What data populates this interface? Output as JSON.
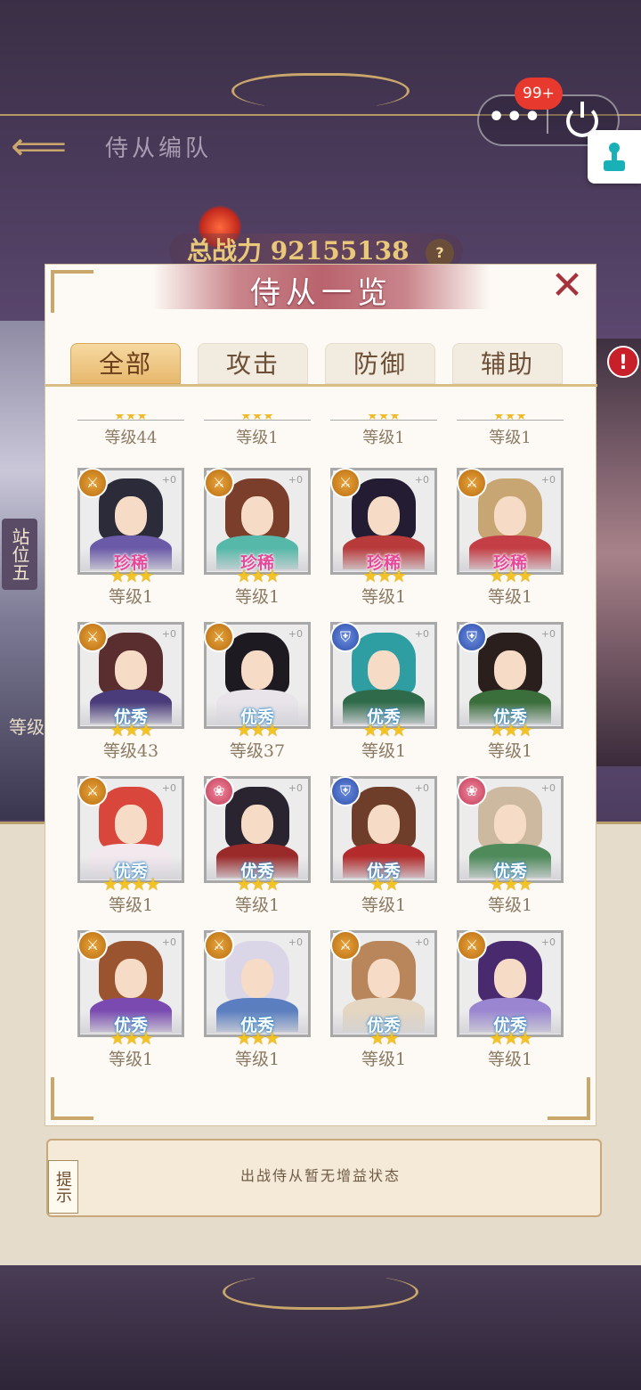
{
  "background": {
    "team_title": "侍从编队",
    "power_label": "总战力",
    "power_value": "92155138",
    "help": "?",
    "stand_tag": "站位五",
    "left_level": "等级",
    "alert": "!",
    "tip_label": "提示",
    "tip_text": "出战侍从暂无增益状态"
  },
  "capsule": {
    "more": "•••",
    "badge": "99+"
  },
  "modal": {
    "title": "侍从一览",
    "close": "✕",
    "tabs": [
      {
        "label": "全部",
        "active": true
      },
      {
        "label": "攻击",
        "active": false
      },
      {
        "label": "防御",
        "active": false
      },
      {
        "label": "辅助",
        "active": false
      }
    ],
    "partial_row": [
      {
        "level": "等级44"
      },
      {
        "level": "等级1"
      },
      {
        "level": "等级1"
      },
      {
        "level": "等级1"
      }
    ],
    "cards": [
      {
        "role": "sword",
        "rarity": "珍稀",
        "tier": "rare",
        "stars": "★★★",
        "level": "等级1",
        "plus": "+0",
        "hair": "#2b2b3a",
        "robe": "#6b5aa8"
      },
      {
        "role": "sword",
        "rarity": "珍稀",
        "tier": "rare",
        "stars": "★★★",
        "level": "等级1",
        "plus": "+0",
        "hair": "#7a3e2a",
        "robe": "#55b8a8"
      },
      {
        "role": "sword",
        "rarity": "珍稀",
        "tier": "rare",
        "stars": "★★★",
        "level": "等级1",
        "plus": "+0",
        "hair": "#231c33",
        "robe": "#b83a3a"
      },
      {
        "role": "sword",
        "rarity": "珍稀",
        "tier": "rare",
        "stars": "★★★",
        "level": "等级1",
        "plus": "+0",
        "hair": "#c8a673",
        "robe": "#c43f45"
      },
      {
        "role": "sword",
        "rarity": "优秀",
        "tier": "good",
        "stars": "★★★",
        "level": "等级43",
        "plus": "+0",
        "hair": "#5a2e2e",
        "robe": "#4a3b7a"
      },
      {
        "role": "sword",
        "rarity": "优秀",
        "tier": "good",
        "stars": "★★★",
        "level": "等级37",
        "plus": "+0",
        "hair": "#1e1a22",
        "robe": "#e8e4ea"
      },
      {
        "role": "shield",
        "rarity": "优秀",
        "tier": "good",
        "stars": "★★★",
        "level": "等级1",
        "plus": "+0",
        "hair": "#2e9ea2",
        "robe": "#2f6b4a"
      },
      {
        "role": "shield",
        "rarity": "优秀",
        "tier": "good",
        "stars": "★★★",
        "level": "等级1",
        "plus": "+0",
        "hair": "#2b1f1e",
        "robe": "#3a6e3a"
      },
      {
        "role": "sword",
        "rarity": "优秀",
        "tier": "good",
        "stars": "★★★★",
        "level": "等级1",
        "plus": "+0",
        "hair": "#d8463c",
        "robe": "#f2e8ee"
      },
      {
        "role": "lotus",
        "rarity": "优秀",
        "tier": "good",
        "stars": "★★★",
        "level": "等级1",
        "plus": "+0",
        "hair": "#2a2430",
        "robe": "#9a2a2a"
      },
      {
        "role": "shield",
        "rarity": "优秀",
        "tier": "good",
        "stars": "★★",
        "level": "等级1",
        "plus": "+0",
        "hair": "#6e3e2a",
        "robe": "#b32b2b"
      },
      {
        "role": "lotus",
        "rarity": "优秀",
        "tier": "good",
        "stars": "★★★",
        "level": "等级1",
        "plus": "+0",
        "hair": "#cdb9a0",
        "robe": "#4e8a5a"
      },
      {
        "role": "sword",
        "rarity": "优秀",
        "tier": "good",
        "stars": "★★★",
        "level": "等级1",
        "plus": "+0",
        "hair": "#9a5530",
        "robe": "#7a4ab0"
      },
      {
        "role": "sword",
        "rarity": "优秀",
        "tier": "good",
        "stars": "★★★",
        "level": "等级1",
        "plus": "+0",
        "hair": "#dad6e8",
        "robe": "#5a7ec0"
      },
      {
        "role": "sword",
        "rarity": "优秀",
        "tier": "good",
        "stars": "★★",
        "level": "等级1",
        "plus": "+0",
        "hair": "#b8865a",
        "robe": "#e4d6c0"
      },
      {
        "role": "sword",
        "rarity": "优秀",
        "tier": "good",
        "stars": "★★★",
        "level": "等级1",
        "plus": "+0",
        "hair": "#4a2a6e",
        "robe": "#9a86d0"
      }
    ]
  }
}
